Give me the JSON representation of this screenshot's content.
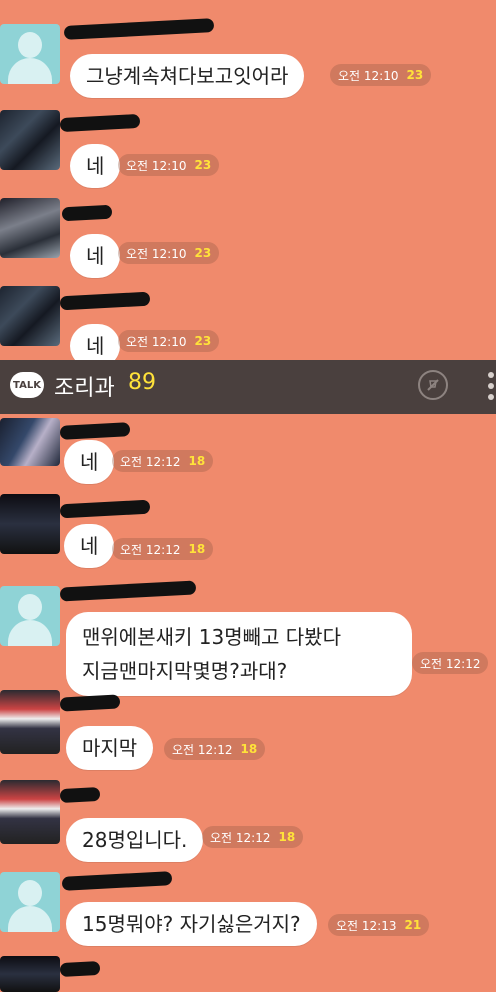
{
  "room": {
    "title": "조리과",
    "member_count": "89"
  },
  "messages": [
    {
      "text": "그냥계속쳐다보고잇어라",
      "time": "오전 12:10",
      "unread": "23"
    },
    {
      "text": "네",
      "time": "오전 12:10",
      "unread": "23"
    },
    {
      "text": "네",
      "time": "오전 12:10",
      "unread": "23"
    },
    {
      "text": "네",
      "time": "오전 12:10",
      "unread": "23"
    },
    {
      "text": "네",
      "time": "오전 12:12",
      "unread": "18"
    },
    {
      "text": "네",
      "time": "오전 12:12",
      "unread": "18"
    },
    {
      "line1": "맨위에본새키 13명빼고 다봤다",
      "line2": "지금맨마지막몇명?과대?",
      "time": "오전 12:12",
      "unread": ""
    },
    {
      "text": "마지막",
      "time": "오전 12:12",
      "unread": "18"
    },
    {
      "text": "28명입니다.",
      "time": "오전 12:12",
      "unread": "18"
    },
    {
      "text": "15명뭐야? 자기싫은거지?",
      "time": "오전 12:13",
      "unread": "21"
    }
  ],
  "icons": {
    "talk": "TALK",
    "mute": "mute-icon",
    "menu": "more-vertical-icon"
  },
  "colors": {
    "background": "#f08a6c",
    "bubble": "#ffffff",
    "unread": "#ffe23a",
    "topbar": "#4a403e"
  }
}
